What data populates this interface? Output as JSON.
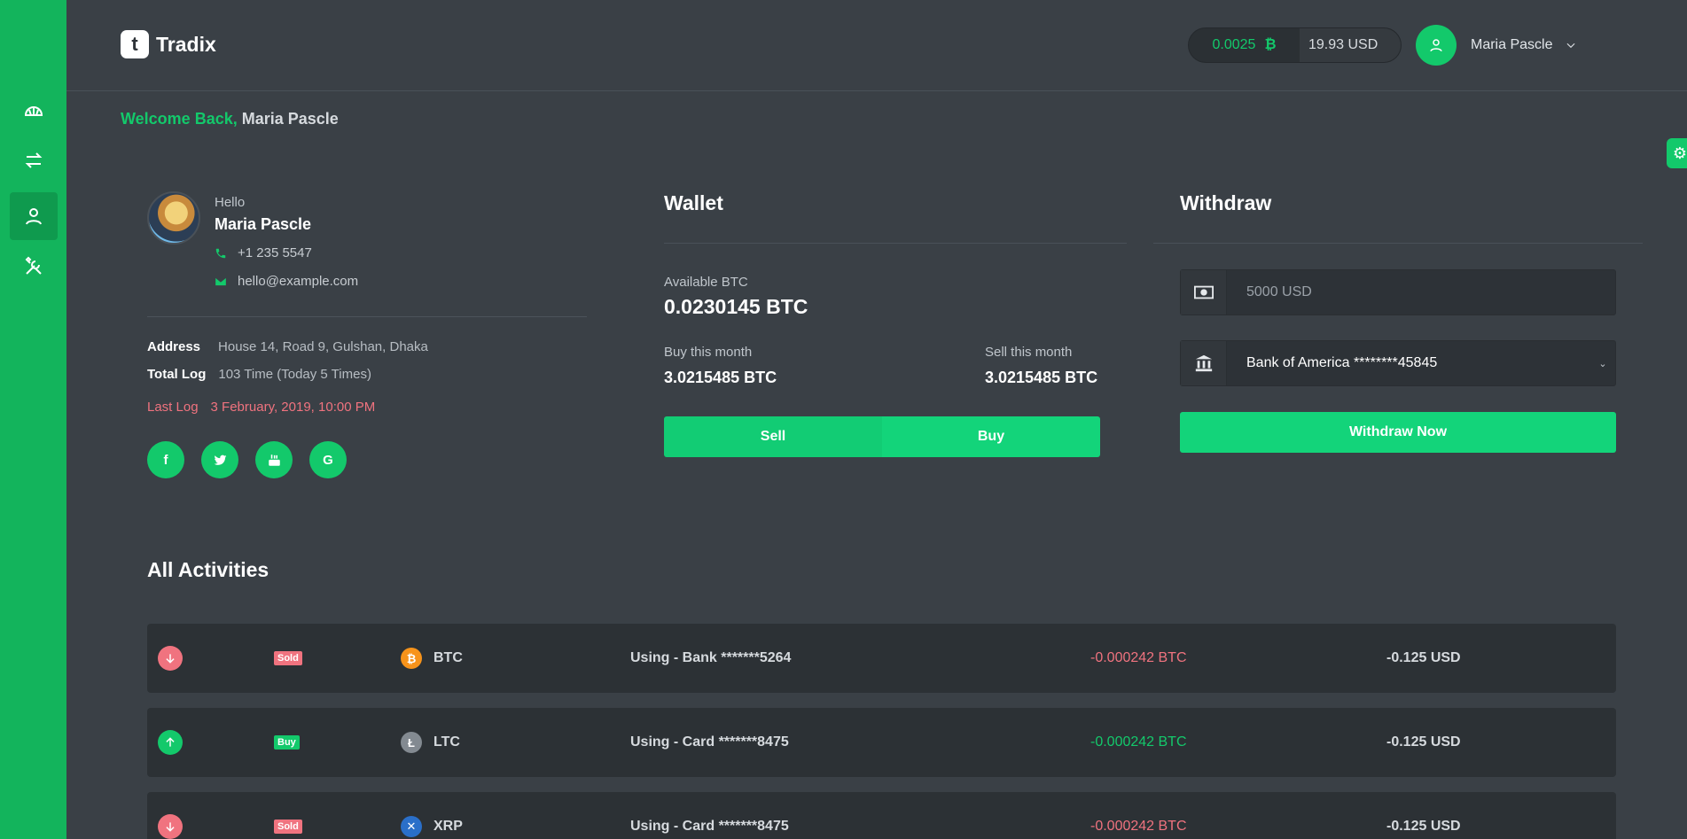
{
  "brand": {
    "logo_letter": "t",
    "name": "Tradix"
  },
  "colors": {
    "accent": "#13c96b",
    "sidebar": "#13b45c",
    "negative": "#f0737f",
    "background": "#3a4046"
  },
  "header": {
    "btc_balance": "0.0025",
    "usd_balance": "19.93 USD",
    "user_name": "Maria Pascle"
  },
  "sidebar": {
    "items": [
      {
        "icon": "dashboard-icon",
        "active": false
      },
      {
        "icon": "exchange-icon",
        "active": false
      },
      {
        "icon": "user-icon",
        "active": true
      },
      {
        "icon": "tools-icon",
        "active": false
      }
    ]
  },
  "welcome": {
    "prefix": "Welcome Back,",
    "name": "Maria Pascle"
  },
  "profile": {
    "greeting": "Hello",
    "name": "Maria Pascle",
    "phone": "+1 235 5547",
    "email": "hello@example.com",
    "address_label": "Address",
    "address": "House 14, Road 9, Gulshan, Dhaka",
    "total_log_label": "Total Log",
    "total_log": "103 Time (Today 5 Times)",
    "last_log_label": "Last Log",
    "last_log": "3 February, 2019, 10:00 PM",
    "social": [
      "facebook-icon",
      "twitter-icon",
      "youtube-icon",
      "google-icon"
    ]
  },
  "wallet": {
    "title": "Wallet",
    "available_label": "Available BTC",
    "available_value": "0.0230145 BTC",
    "buy_label": "Buy this month",
    "buy_value": "3.0215485 BTC",
    "sell_label": "Sell this month",
    "sell_value": "3.0215485 BTC",
    "sell_button": "Sell",
    "buy_button": "Buy"
  },
  "withdraw": {
    "title": "Withdraw",
    "amount_placeholder": "5000 USD",
    "bank_selected": "Bank of America ********45845",
    "button": "Withdraw Now"
  },
  "activities": {
    "title": "All Activities",
    "rows": [
      {
        "direction": "down",
        "badge": "Sold",
        "coin": "BTC",
        "using": "Using - Bank *******5264",
        "btc": "-0.000242 BTC",
        "usd": "-0.125 USD",
        "btc_color": "#f0737f",
        "coin_color": "#f7931a",
        "coin_glyph": "₿"
      },
      {
        "direction": "up",
        "badge": "Buy",
        "coin": "LTC",
        "using": "Using - Card *******8475",
        "btc": "-0.000242 BTC",
        "usd": "-0.125 USD",
        "btc_color": "#13c96b",
        "coin_color": "#838a91",
        "coin_glyph": "Ł"
      },
      {
        "direction": "down",
        "badge": "Sold",
        "coin": "XRP",
        "using": "Using - Card *******8475",
        "btc": "-0.000242 BTC",
        "usd": "-0.125 USD",
        "btc_color": "#f0737f",
        "coin_color": "#2a6fc9",
        "coin_glyph": "✕"
      }
    ]
  }
}
